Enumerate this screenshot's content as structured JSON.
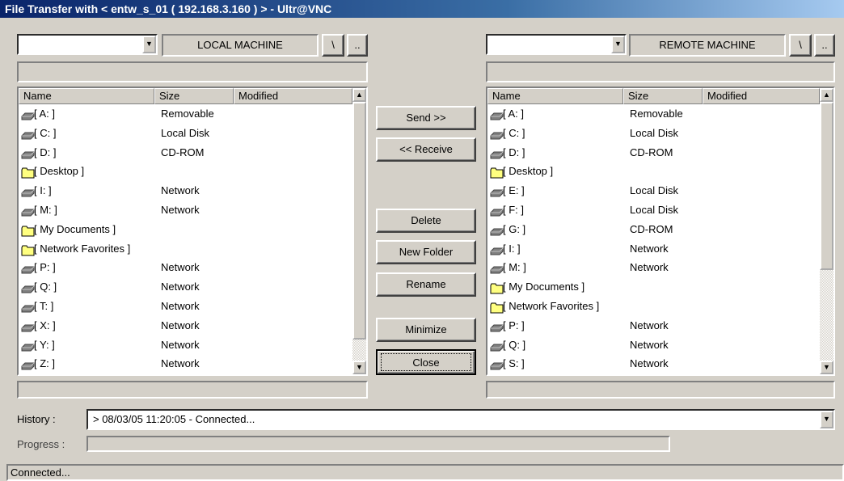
{
  "window": {
    "title": "File Transfer with < entw_s_01 ( 192.168.3.160 ) >  -  Ultr@VNC"
  },
  "local": {
    "label": "LOCAL MACHINE",
    "root_button": "\\",
    "up_button": "..",
    "columns": [
      "Name",
      "Size",
      "Modified"
    ],
    "items": [
      {
        "name": "[ A: ]",
        "size": "Removable",
        "icon": "drive-icon"
      },
      {
        "name": "[ C: ]",
        "size": "Local Disk",
        "icon": "drive-icon"
      },
      {
        "name": "[ D: ]",
        "size": "CD-ROM",
        "icon": "drive-icon"
      },
      {
        "name": "[ Desktop ]",
        "size": "",
        "icon": "folder-icon"
      },
      {
        "name": "[ I: ]",
        "size": "Network",
        "icon": "drive-icon"
      },
      {
        "name": "[ M: ]",
        "size": "Network",
        "icon": "drive-icon"
      },
      {
        "name": "[ My Documents ]",
        "size": "",
        "icon": "folder-icon"
      },
      {
        "name": "[ Network Favorites ]",
        "size": "",
        "icon": "folder-icon"
      },
      {
        "name": "[ P: ]",
        "size": "Network",
        "icon": "drive-icon"
      },
      {
        "name": "[ Q: ]",
        "size": "Network",
        "icon": "drive-icon"
      },
      {
        "name": "[ T: ]",
        "size": "Network",
        "icon": "drive-icon"
      },
      {
        "name": "[ X: ]",
        "size": "Network",
        "icon": "drive-icon"
      },
      {
        "name": "[ Y: ]",
        "size": "Network",
        "icon": "drive-icon"
      },
      {
        "name": "[ Z: ]",
        "size": "Network",
        "icon": "drive-icon"
      }
    ]
  },
  "remote": {
    "label": "REMOTE MACHINE",
    "root_button": "\\",
    "up_button": "..",
    "columns": [
      "Name",
      "Size",
      "Modified"
    ],
    "items": [
      {
        "name": "[ A: ]",
        "size": "Removable",
        "icon": "drive-icon"
      },
      {
        "name": "[ C: ]",
        "size": "Local Disk",
        "icon": "drive-icon"
      },
      {
        "name": "[ D: ]",
        "size": "CD-ROM",
        "icon": "drive-icon"
      },
      {
        "name": "[ Desktop ]",
        "size": "",
        "icon": "folder-icon"
      },
      {
        "name": "[ E: ]",
        "size": "Local Disk",
        "icon": "drive-icon"
      },
      {
        "name": "[ F: ]",
        "size": "Local Disk",
        "icon": "drive-icon"
      },
      {
        "name": "[ G: ]",
        "size": "CD-ROM",
        "icon": "drive-icon"
      },
      {
        "name": "[ I: ]",
        "size": "Network",
        "icon": "drive-icon"
      },
      {
        "name": "[ M: ]",
        "size": "Network",
        "icon": "drive-icon"
      },
      {
        "name": "[ My Documents ]",
        "size": "",
        "icon": "folder-icon"
      },
      {
        "name": "[ Network Favorites ]",
        "size": "",
        "icon": "folder-icon"
      },
      {
        "name": "[ P: ]",
        "size": "Network",
        "icon": "drive-icon"
      },
      {
        "name": "[ Q: ]",
        "size": "Network",
        "icon": "drive-icon"
      },
      {
        "name": "[ S: ]",
        "size": "Network",
        "icon": "drive-icon"
      }
    ]
  },
  "buttons": {
    "send": "Send >>",
    "receive": "<< Receive",
    "delete": "Delete",
    "new_folder": "New Folder",
    "rename": "Rename",
    "minimize": "Minimize",
    "close": "Close"
  },
  "history": {
    "label": "History :",
    "value": "> 08/03/05 11:20:05 -  Connected..."
  },
  "progress": {
    "label": "Progress :",
    "value": 0
  },
  "status": {
    "text": "Connected..."
  },
  "colors": {
    "titlebar": "#0a246a",
    "face": "#d4d0c8",
    "folder": "#ffff80"
  }
}
